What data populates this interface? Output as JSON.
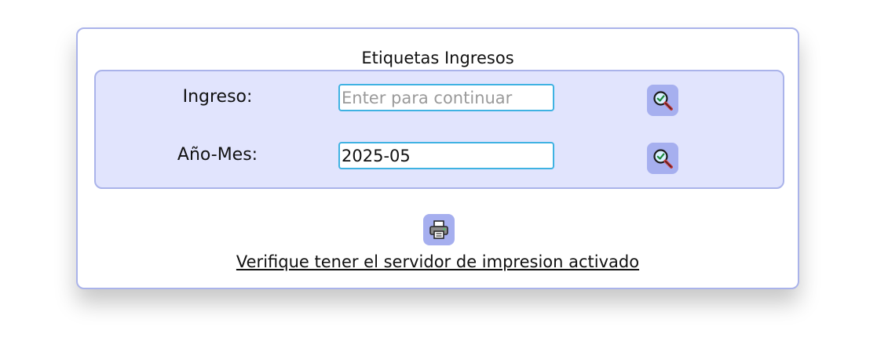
{
  "form": {
    "title": "Etiquetas Ingresos",
    "ingreso": {
      "label": "Ingreso:",
      "value": "",
      "placeholder": "Enter para continuar"
    },
    "anio_mes": {
      "label": "Año-Mes:",
      "value": "2025-05",
      "placeholder": ""
    },
    "search_icon": "search-check-icon",
    "print_icon": "printer-icon",
    "notice": "Verifique tener el servidor de impresion activado"
  },
  "colors": {
    "panel_bg": "#e1e4fd",
    "border": "#aab3ea",
    "icon_button_bg": "#a6afef",
    "input_border": "#3fb2e2"
  }
}
